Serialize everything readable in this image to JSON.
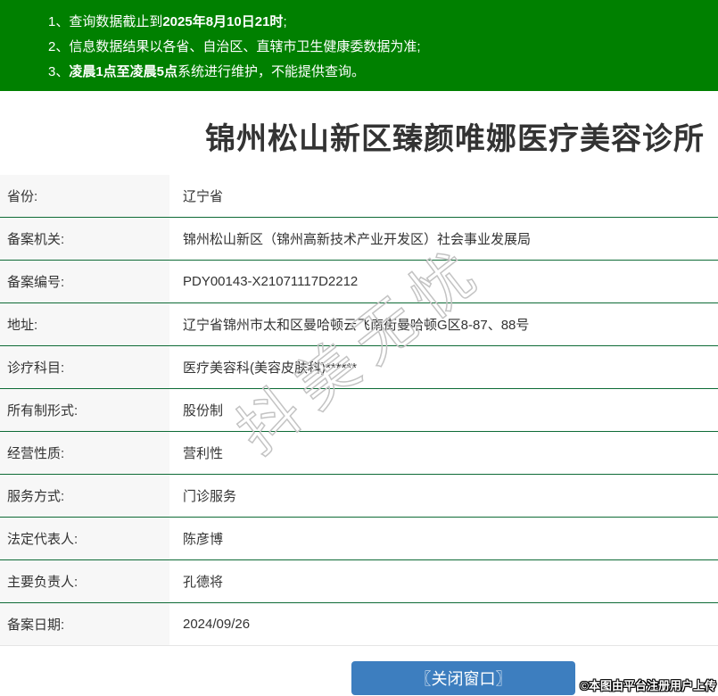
{
  "banner": {
    "bg_color": "#008000",
    "notices": [
      {
        "before": "1、查询数据截止到",
        "bold": "2025年8月10日21时",
        "after": ";"
      },
      {
        "before": "2、信息数据结果以各省、自治区、直辖市卫生健康委数据为准;",
        "bold": "",
        "after": ""
      },
      {
        "before": "3、",
        "bold": "凌晨1点至凌晨5点",
        "after": "系统进行维护，不能提供查询。"
      }
    ]
  },
  "page": {
    "title": "锦州松山新区臻颜唯娜医疗美容诊所"
  },
  "table": {
    "rows": [
      {
        "label": "省份:",
        "value": "辽宁省"
      },
      {
        "label": "备案机关:",
        "value": "锦州松山新区（锦州高新技术产业开发区）社会事业发展局"
      },
      {
        "label": "备案编号:",
        "value": "PDY00143-X21071117D2212"
      },
      {
        "label": "地址:",
        "value": "辽宁省锦州市太和区曼哈顿云飞南街曼哈顿G区8-87、88号"
      },
      {
        "label": "诊疗科目:",
        "value": "医疗美容科(美容皮肤科)******"
      },
      {
        "label": "所有制形式:",
        "value": "股份制"
      },
      {
        "label": "经营性质:",
        "value": "营利性"
      },
      {
        "label": "服务方式:",
        "value": "门诊服务"
      },
      {
        "label": "法定代表人:",
        "value": "陈彦博"
      },
      {
        "label": "主要负责人:",
        "value": "孔德将"
      },
      {
        "label": "备案日期:",
        "value": "2024/09/26"
      }
    ]
  },
  "footer": {
    "close_button_label": "〖关闭窗口〗"
  },
  "watermarks": {
    "diagonal": "抖美无忧",
    "corner": "©本图由平台注册用户上传"
  },
  "colors": {
    "banner_green": "#008000",
    "divider_green": "#0e6b36",
    "label_bg": "#f7f7f7",
    "button_blue": "#3d7ebf",
    "text": "#333333"
  }
}
